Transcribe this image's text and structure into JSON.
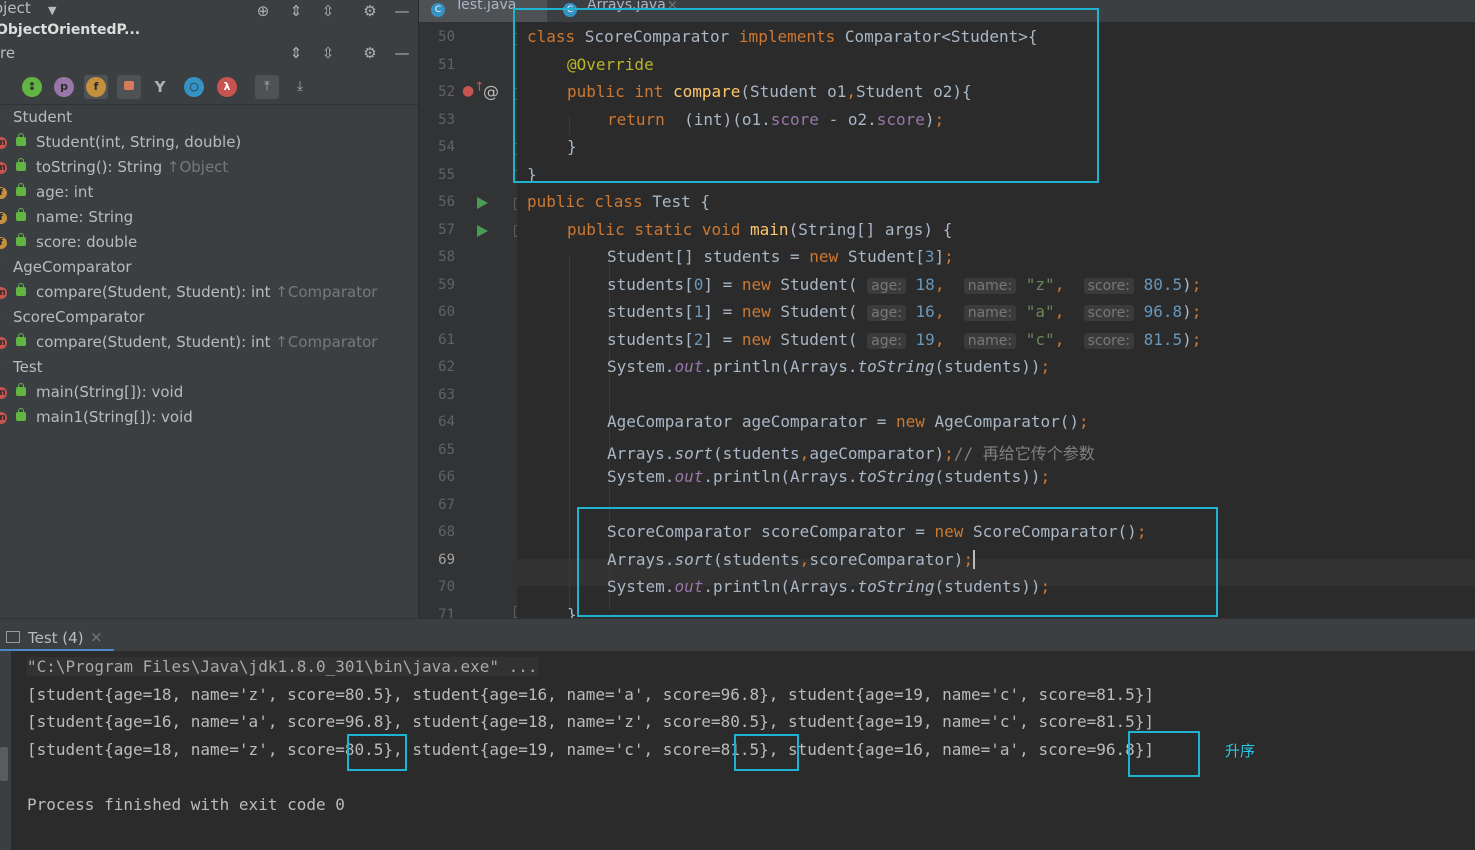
{
  "left_panel": {
    "header_title": "oject",
    "header_subtitle": "ObjectOrientedP...",
    "structure_title": "re",
    "tree": [
      {
        "label": "Student",
        "suffix": "",
        "kind": "class"
      },
      {
        "label": "Student(int, String, double)",
        "suffix": "",
        "kind": "method"
      },
      {
        "label": "toString(): String ",
        "suffix": "↑Object",
        "kind": "method"
      },
      {
        "label": "age: int",
        "suffix": "",
        "kind": "field"
      },
      {
        "label": "name: String",
        "suffix": "",
        "kind": "field"
      },
      {
        "label": "score: double",
        "suffix": "",
        "kind": "field"
      },
      {
        "label": "AgeComparator",
        "suffix": "",
        "kind": "class"
      },
      {
        "label": "compare(Student, Student): int ",
        "suffix": "↑Comparator",
        "kind": "method"
      },
      {
        "label": "ScoreComparator",
        "suffix": "",
        "kind": "class"
      },
      {
        "label": "compare(Student, Student): int ",
        "suffix": "↑Comparator",
        "kind": "method"
      },
      {
        "label": "Test",
        "suffix": "",
        "kind": "class"
      },
      {
        "label": "main(String[]): void",
        "suffix": "",
        "kind": "method"
      },
      {
        "label": "main1(String[]): void",
        "suffix": "",
        "kind": "method"
      }
    ],
    "filter_icons": [
      "sort-icon",
      "show-properties-icon",
      "show-fields-icon",
      "show-nonpublic-icon",
      "inherited-icon",
      "anonymous-icon",
      "lambda-icon",
      "expand-icon",
      "collapse-icon"
    ]
  },
  "tabs": [
    {
      "label": "Test.java",
      "active": true
    },
    {
      "label": "Arrays.java",
      "active": false
    }
  ],
  "editor": {
    "line_numbers": [
      "50",
      "51",
      "52",
      "53",
      "54",
      "55",
      "56",
      "57",
      "58",
      "59",
      "60",
      "61",
      "62",
      "63",
      "64",
      "65",
      "66",
      "67",
      "68",
      "69",
      "70",
      "71"
    ],
    "current_line": "69",
    "hints": {
      "age": "age:",
      "name": "name:",
      "score": "score:"
    },
    "strings": {
      "l50_kw": "class ",
      "l50_name": "ScoreComparator ",
      "l50_kw2": "implements ",
      "l50_rest": "Comparator<Student>{",
      "l51_ann": "@Override",
      "l52_kw": "public int ",
      "l52_fn": "compare",
      "l52_a": "(Student o1",
      "l52_comma": ",",
      "l52_b": "Student o2){",
      "l53_kw": "return  ",
      "l53_a": "(int)(o1.",
      "l53_f1": "score",
      "l53_b": " - o2.",
      "l53_f2": "score",
      "l53_c": ")",
      "l53_semi": ";",
      "l54": "}",
      "l55": "}",
      "l56_kw": "public class ",
      "l56_rest": "Test {",
      "l57_kw": "public static void ",
      "l57_fn": "main",
      "l57_rest": "(String[] args) {",
      "l58_a": "Student[] students = ",
      "l58_kw": "new ",
      "l58_b": "Student[",
      "l58_num": "3",
      "l58_c": "]",
      "l58_semi": ";",
      "l59_a": "students[",
      "l59_idx": "0",
      "l59_b": "] = ",
      "l59_kw": "new ",
      "l59_c": "Student(",
      "l59_age": "18",
      "l59_name": "\"z\"",
      "l59_score": "80.5",
      "l60_a": "students[",
      "l60_idx": "1",
      "l60_b": "] = ",
      "l60_kw": "new ",
      "l60_c": "Student(",
      "l60_age": "16",
      "l60_name": "\"a\"",
      "l60_score": "96.8",
      "l61_a": "students[",
      "l61_idx": "2",
      "l61_b": "] = ",
      "l61_kw": "new ",
      "l61_c": "Student(",
      "l61_age": "19",
      "l61_name": "\"c\"",
      "l61_score": "81.5",
      "comma": ", ",
      "close": ")",
      "semi": ";",
      "sys_a": "System.",
      "sys_out": "out",
      "sys_b": ".println(Arrays.",
      "sys_ts": "toString",
      "sys_c": "(students))",
      "l64_a": "AgeComparator ageComparator = ",
      "l64_kw": "new ",
      "l64_b": "AgeComparator()",
      "l65_a": "Arrays.",
      "l65_sort": "sort",
      "l65_b": "(students",
      "l65_comma": ",",
      "l65_c": "ageComparator)",
      "l65_cmt": "// 再给它传个参数",
      "l68_a": "ScoreComparator scoreComparator = ",
      "l68_kw": "new ",
      "l68_b": "ScoreComparator()",
      "l69_a": "Arrays.",
      "l69_sort": "sort",
      "l69_b": "(students",
      "l69_comma": ",",
      "l69_c": "scoreComparator)",
      "l71": "}"
    }
  },
  "run_panel": {
    "tab_label": "Test (4)",
    "command": "\"C:\\Program Files\\Java\\jdk1.8.0_301\\bin\\java.exe\" ...",
    "output": [
      "[student{age=18, name='z', score=80.5}, student{age=16, name='a', score=96.8}, student{age=19, name='c', score=81.5}]",
      "[student{age=16, name='a', score=96.8}, student{age=18, name='z', score=80.5}, student{age=19, name='c', score=81.5}]",
      "[student{age=18, name='z', score=80.5}, student{age=19, name='c', score=81.5}, student{age=16, name='a', score=96.8}]"
    ],
    "exit": "Process finished with exit code 0",
    "annotation": "升序"
  },
  "colors": {
    "highlight": "#1fb3d2",
    "keyword": "#cc7832",
    "number": "#6897bb",
    "string": "#6a8759"
  }
}
